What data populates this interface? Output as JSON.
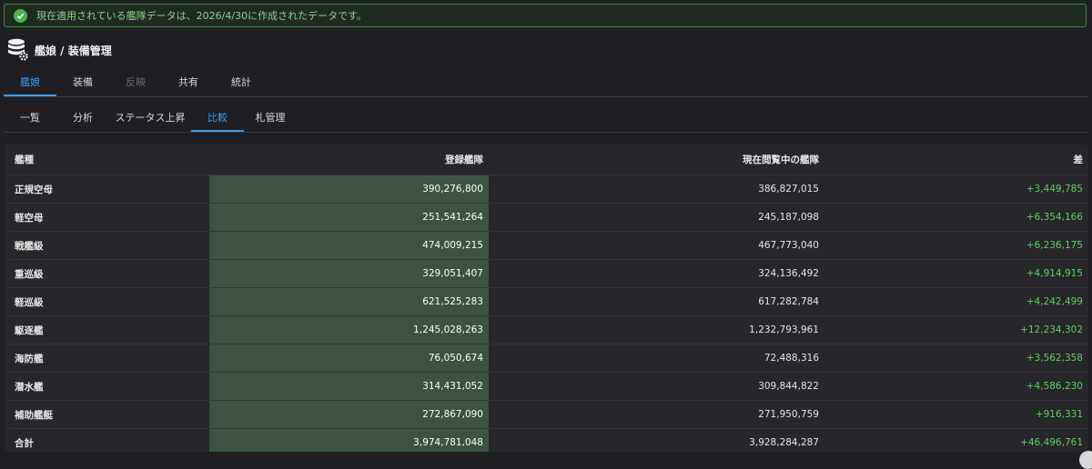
{
  "alert": {
    "message": "現在適用されている艦隊データは、2026/4/30に作成されたデータです。",
    "icon": "check-circle-icon",
    "color": "#48b54a"
  },
  "header": {
    "title": "艦娘 / 装備管理",
    "icon": "database-gear-icon"
  },
  "main_tabs": [
    {
      "label": "艦娘",
      "state": "active"
    },
    {
      "label": "装備",
      "state": "normal"
    },
    {
      "label": "反映",
      "state": "disabled"
    },
    {
      "label": "共有",
      "state": "normal"
    },
    {
      "label": "統計",
      "state": "normal"
    }
  ],
  "sub_tabs": [
    {
      "label": "一覧",
      "state": "normal"
    },
    {
      "label": "分析",
      "state": "normal"
    },
    {
      "label": "ステータス上昇",
      "state": "normal"
    },
    {
      "label": "比較",
      "state": "active"
    },
    {
      "label": "札管理",
      "state": "normal"
    }
  ],
  "table": {
    "headers": [
      "艦種",
      "登録艦隊",
      "現在閲覧中の艦隊",
      "差"
    ],
    "rows": [
      [
        "正規空母",
        "390,276,800",
        "386,827,015",
        "+3,449,785"
      ],
      [
        "軽空母",
        "251,541,264",
        "245,187,098",
        "+6,354,166"
      ],
      [
        "戦艦級",
        "474,009,215",
        "467,773,040",
        "+6,236,175"
      ],
      [
        "重巡級",
        "329,051,407",
        "324,136,492",
        "+4,914,915"
      ],
      [
        "軽巡級",
        "621,525,283",
        "617,282,784",
        "+4,242,499"
      ],
      [
        "駆逐艦",
        "1,245,028,263",
        "1,232,793,961",
        "+12,234,302"
      ],
      [
        "海防艦",
        "76,050,674",
        "72,488,316",
        "+3,562,358"
      ],
      [
        "潜水艦",
        "314,431,052",
        "309,844,822",
        "+4,586,230"
      ],
      [
        "補助艦艇",
        "272,867,090",
        "271,950,759",
        "+916,331"
      ],
      [
        "合計",
        "3,974,781,048",
        "3,928,284,287",
        "+46,496,761"
      ]
    ]
  },
  "colors": {
    "accent": "#3d9df2",
    "positive": "#5fd35f",
    "highlight_column": "#3b5340"
  }
}
